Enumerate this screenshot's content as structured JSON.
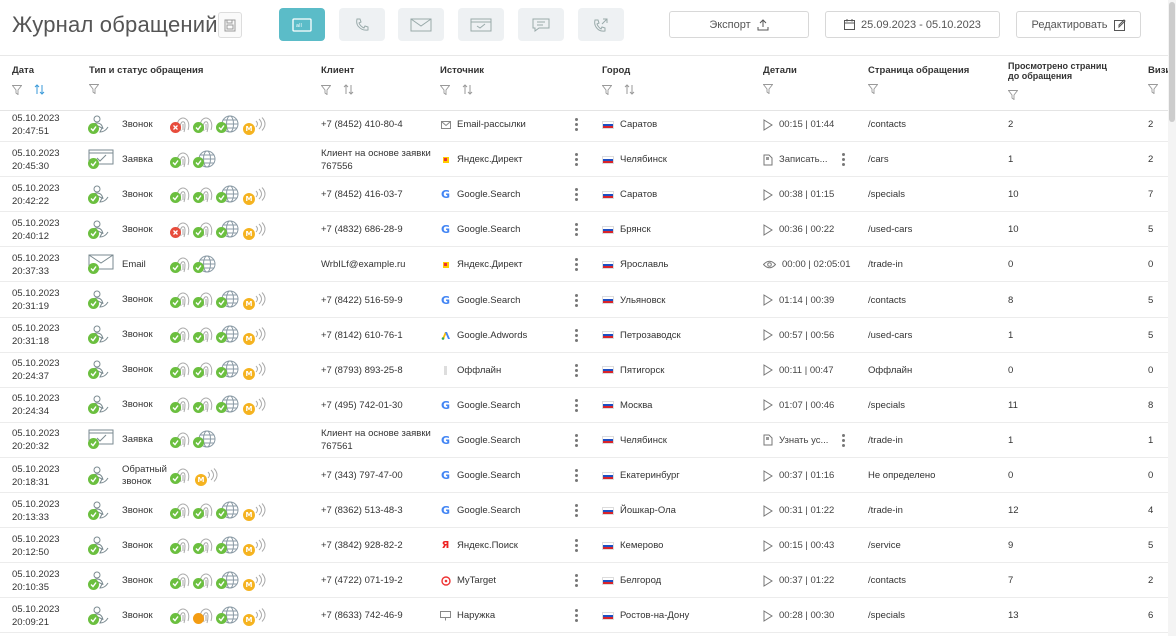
{
  "header": {
    "title": "Журнал обращений",
    "export_label": "Экспорт",
    "date_range": "25.09.2023 - 05.10.2023",
    "edit_label": "Редактировать",
    "type_filters": [
      "all",
      "calls",
      "email",
      "requests",
      "chat",
      "callback"
    ],
    "accent_color": "#5bbcc8"
  },
  "columns": {
    "date": "Дата",
    "type": "Тип и статус обращения",
    "client": "Клиент",
    "source": "Источник",
    "city": "Город",
    "details": "Детали",
    "page": "Страница обращения",
    "viewed": "Просмотрено страниц до обращения",
    "visits": "Визи"
  },
  "rows": [
    {
      "date": "05.10.2023",
      "time": "20:47:51",
      "kind": "call",
      "label": "Звонок",
      "st": [
        "x",
        "ok",
        "ok",
        "m"
      ],
      "client": "+7 (8452) 410-80-4",
      "source": "Email-рассылки",
      "src": "mail",
      "city": "Саратов",
      "dtype": "play",
      "details": "00:15 | 01:44",
      "page": "/contacts",
      "viewed": "2",
      "visits": "2"
    },
    {
      "date": "05.10.2023",
      "time": "20:45:30",
      "kind": "request",
      "label": "Заявка",
      "st": [
        "ok",
        "ok"
      ],
      "client": "Клиент на основе заявки 767556",
      "source": "Яндекс.Директ",
      "src": "ydirect",
      "city": "Челябинск",
      "dtype": "doc",
      "details": "Записать...",
      "page": "/cars",
      "viewed": "1",
      "visits": "2"
    },
    {
      "date": "05.10.2023",
      "time": "20:42:22",
      "kind": "call",
      "label": "Звонок",
      "st": [
        "ok",
        "ok",
        "ok",
        "m"
      ],
      "client": "+7 (8452) 416-03-7",
      "source": "Google.Search",
      "src": "google",
      "city": "Саратов",
      "dtype": "play",
      "details": "00:38 | 01:15",
      "page": "/specials",
      "viewed": "10",
      "visits": "7"
    },
    {
      "date": "05.10.2023",
      "time": "20:40:12",
      "kind": "call",
      "label": "Звонок",
      "st": [
        "x",
        "ok",
        "ok",
        "m"
      ],
      "client": "+7 (4832) 686-28-9",
      "source": "Google.Search",
      "src": "google",
      "city": "Брянск",
      "dtype": "play",
      "details": "00:36 | 00:22",
      "page": "/used-cars",
      "viewed": "10",
      "visits": "5"
    },
    {
      "date": "05.10.2023",
      "time": "20:37:33",
      "kind": "email",
      "label": "Email",
      "st": [
        "ok",
        "ok"
      ],
      "client": "WrbILf@example.ru",
      "source": "Яндекс.Директ",
      "src": "ydirect",
      "city": "Ярославль",
      "dtype": "eye",
      "details": "00:00 | 02:05:01",
      "page": "/trade-in",
      "viewed": "0",
      "visits": "0"
    },
    {
      "date": "05.10.2023",
      "time": "20:31:19",
      "kind": "call",
      "label": "Звонок",
      "st": [
        "ok",
        "ok",
        "ok",
        "m"
      ],
      "client": "+7 (8422) 516-59-9",
      "source": "Google.Search",
      "src": "google",
      "city": "Ульяновск",
      "dtype": "play",
      "details": "01:14 | 00:39",
      "page": "/contacts",
      "viewed": "8",
      "visits": "5"
    },
    {
      "date": "05.10.2023",
      "time": "20:31:18",
      "kind": "call",
      "label": "Звонок",
      "st": [
        "ok",
        "ok",
        "ok",
        "m"
      ],
      "client": "+7 (8142) 610-76-1",
      "source": "Google.Adwords",
      "src": "adwords",
      "city": "Петрозаводск",
      "dtype": "play",
      "details": "00:57 | 00:56",
      "page": "/used-cars",
      "viewed": "1",
      "visits": "5"
    },
    {
      "date": "05.10.2023",
      "time": "20:24:37",
      "kind": "call",
      "label": "Звонок",
      "st": [
        "ok",
        "ok",
        "ok",
        "m"
      ],
      "client": "+7 (8793) 893-25-8",
      "source": "Оффлайн",
      "src": "offline",
      "city": "Пятигорск",
      "dtype": "play",
      "details": "00:11 | 00:47",
      "page": "Оффлайн",
      "viewed": "0",
      "visits": "0"
    },
    {
      "date": "05.10.2023",
      "time": "20:24:34",
      "kind": "call",
      "label": "Звонок",
      "st": [
        "ok",
        "ok",
        "ok",
        "m"
      ],
      "client": "+7 (495) 742-01-30",
      "source": "Google.Search",
      "src": "google",
      "city": "Москва",
      "dtype": "play",
      "details": "01:07 | 00:46",
      "page": "/specials",
      "viewed": "11",
      "visits": "8"
    },
    {
      "date": "05.10.2023",
      "time": "20:20:32",
      "kind": "request",
      "label": "Заявка",
      "st": [
        "ok",
        "ok"
      ],
      "client": "Клиент на основе заявки 767561",
      "source": "Google.Search",
      "src": "google",
      "city": "Челябинск",
      "dtype": "doc",
      "details": "Узнать ус...",
      "page": "/trade-in",
      "viewed": "1",
      "visits": "1"
    },
    {
      "date": "05.10.2023",
      "time": "20:18:31",
      "kind": "callback",
      "label": "Обратный звонок",
      "st": [
        "ok",
        "m"
      ],
      "client": "+7 (343) 797-47-00",
      "source": "Google.Search",
      "src": "google",
      "city": "Екатеринбург",
      "dtype": "play",
      "details": "00:37 | 01:16",
      "page": "Не определено",
      "viewed": "0",
      "visits": "0"
    },
    {
      "date": "05.10.2023",
      "time": "20:13:33",
      "kind": "call",
      "label": "Звонок",
      "st": [
        "ok",
        "ok",
        "ok",
        "m"
      ],
      "client": "+7 (8362) 513-48-3",
      "source": "Google.Search",
      "src": "google",
      "city": "Йошкар-Ола",
      "dtype": "play",
      "details": "00:31 | 01:22",
      "page": "/trade-in",
      "viewed": "12",
      "visits": "4"
    },
    {
      "date": "05.10.2023",
      "time": "20:12:50",
      "kind": "call",
      "label": "Звонок",
      "st": [
        "ok",
        "ok",
        "ok",
        "m"
      ],
      "client": "+7 (3842) 928-82-2",
      "source": "Яндекс.Поиск",
      "src": "ysearch",
      "city": "Кемерово",
      "dtype": "play",
      "details": "00:15 | 00:43",
      "page": "/service",
      "viewed": "9",
      "visits": "5"
    },
    {
      "date": "05.10.2023",
      "time": "20:10:35",
      "kind": "call",
      "label": "Звонок",
      "st": [
        "ok",
        "ok",
        "ok",
        "m"
      ],
      "client": "+7 (4722) 071-19-2",
      "source": "MyTarget",
      "src": "mytarget",
      "city": "Белгород",
      "dtype": "play",
      "details": "00:37 | 01:22",
      "page": "/contacts",
      "viewed": "7",
      "visits": "2"
    },
    {
      "date": "05.10.2023",
      "time": "20:09:21",
      "kind": "call",
      "label": "Звонок",
      "st": [
        "ok",
        "orange",
        "ok",
        "m"
      ],
      "client": "+7 (8633) 742-46-9",
      "source": "Наружка",
      "src": "outdoor",
      "city": "Ростов-на-Дону",
      "dtype": "play",
      "details": "00:28 | 00:30",
      "page": "/specials",
      "viewed": "13",
      "visits": "6"
    }
  ]
}
